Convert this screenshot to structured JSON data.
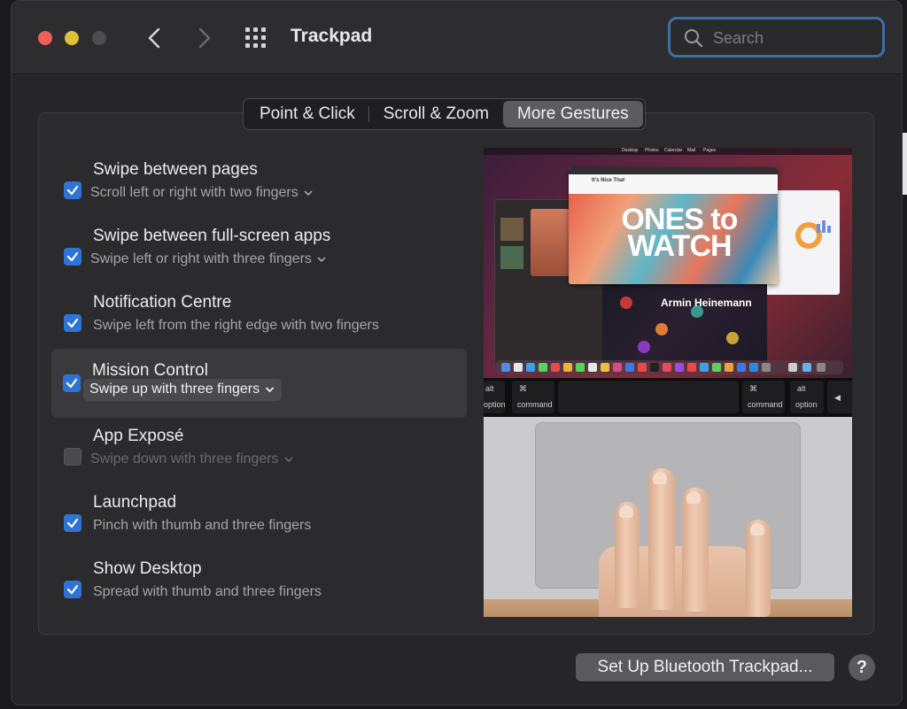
{
  "window": {
    "title": "Trackpad"
  },
  "search": {
    "placeholder": "Search"
  },
  "tabs": [
    {
      "label": "Point & Click"
    },
    {
      "label": "Scroll & Zoom"
    },
    {
      "label": "More Gestures",
      "selected": true
    }
  ],
  "gestures": [
    {
      "title": "Swipe between pages",
      "subtitle": "Scroll left or right with two fingers",
      "checked": true,
      "has_menu": true
    },
    {
      "title": "Swipe between full-screen apps",
      "subtitle": "Swipe left or right with three fingers",
      "checked": true,
      "has_menu": true
    },
    {
      "title": "Notification Centre",
      "subtitle": "Swipe left from the right edge with two fingers",
      "checked": true,
      "has_menu": false
    },
    {
      "title": "Mission Control",
      "subtitle": "Swipe up with three fingers",
      "checked": true,
      "has_menu": true,
      "selected": true
    },
    {
      "title": "App Exposé",
      "subtitle": "Swipe down with three fingers",
      "checked": false,
      "has_menu": true
    },
    {
      "title": "Launchpad",
      "subtitle": "Pinch with thumb and three fingers",
      "checked": true,
      "has_menu": false
    },
    {
      "title": "Show Desktop",
      "subtitle": "Spread with thumb and three fingers",
      "checked": true,
      "has_menu": false
    }
  ],
  "preview": {
    "headline_line1": "ONES to",
    "headline_line2": "WATCH",
    "caption": "Armin Heinemann",
    "menubar": [
      "Desktop",
      "Photos",
      "Calendar",
      "Mail",
      "Pages"
    ],
    "site_name": "It's Nice That",
    "keys": {
      "left_alt": {
        "top": "alt",
        "bottom": "option"
      },
      "left_cmd": {
        "top": "⌘",
        "bottom": "command"
      },
      "right_cmd": {
        "top": "⌘",
        "bottom": "command"
      },
      "right_alt": {
        "top": "alt",
        "bottom": "option"
      },
      "arrow": "◀"
    }
  },
  "footer": {
    "setup_button": "Set Up Bluetooth Trackpad...",
    "help": "?"
  },
  "colors": {
    "accent": "#2f74d5",
    "search_focus": "#3d6fa6",
    "close": "#ec5f58",
    "minimize": "#e1bf3a"
  }
}
